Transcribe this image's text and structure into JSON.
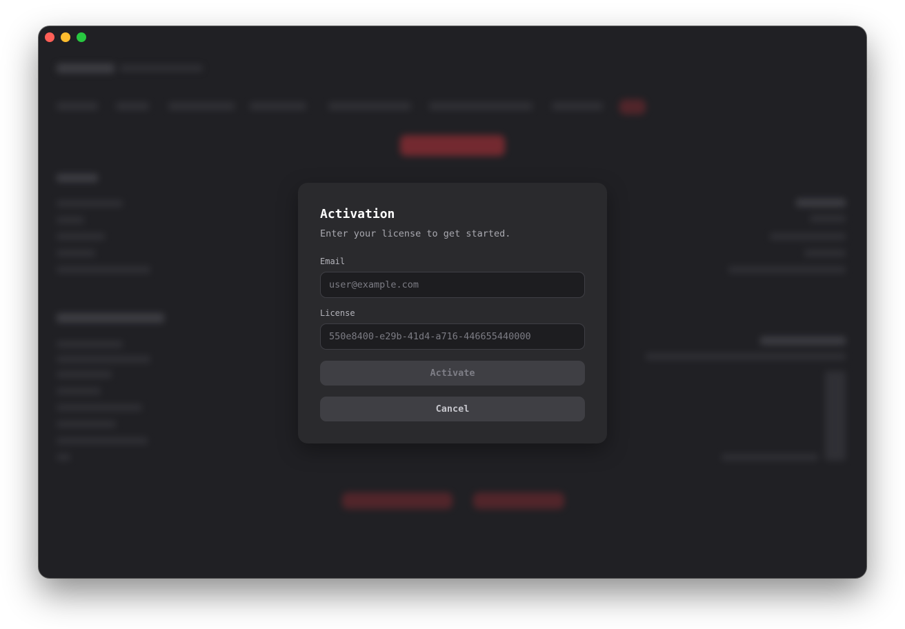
{
  "window": {
    "controls": [
      "close",
      "minimize",
      "maximize"
    ]
  },
  "modal": {
    "title": "Activation",
    "subtitle": "Enter your license to get started.",
    "email": {
      "label": "Email",
      "placeholder": "user@example.com",
      "value": ""
    },
    "license": {
      "label": "License",
      "placeholder": "550e8400-e29b-41d4-a716-446655440000",
      "value": ""
    },
    "activate_label": "Activate",
    "cancel_label": "Cancel"
  }
}
